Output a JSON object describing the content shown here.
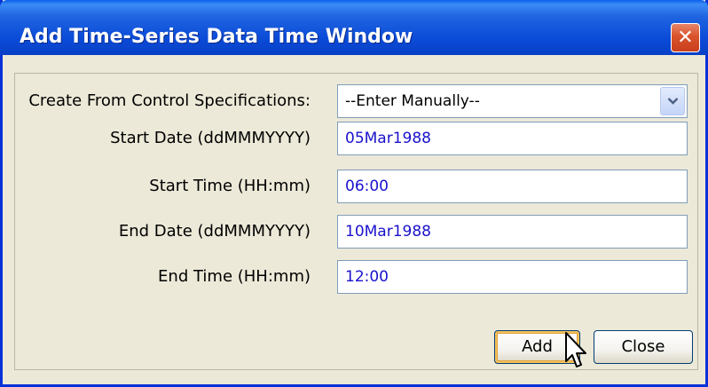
{
  "window": {
    "title": "Add Time-Series Data Time Window",
    "close_glyph": "✕"
  },
  "form": {
    "control_spec_label": "Create From Control Specifications:",
    "control_spec_value": "--Enter Manually--",
    "start_date_label": "Start Date (ddMMMYYYY)",
    "start_date_value": "05Mar1988",
    "start_time_label": "Start Time (HH:mm)",
    "start_time_value": "06:00",
    "end_date_label": "End Date (ddMMMYYYY)",
    "end_date_value": "10Mar1988",
    "end_time_label": "End Time (HH:mm)",
    "end_time_value": "12:00"
  },
  "buttons": {
    "add_label": "Add",
    "close_label": "Close"
  },
  "colors": {
    "titlebar": "#0B4BD8",
    "input_text": "#1A12CC",
    "close_button": "#D9532B"
  },
  "icons": {
    "close": "close-icon",
    "dropdown": "chevron-down-icon",
    "cursor": "mouse-pointer-icon"
  }
}
